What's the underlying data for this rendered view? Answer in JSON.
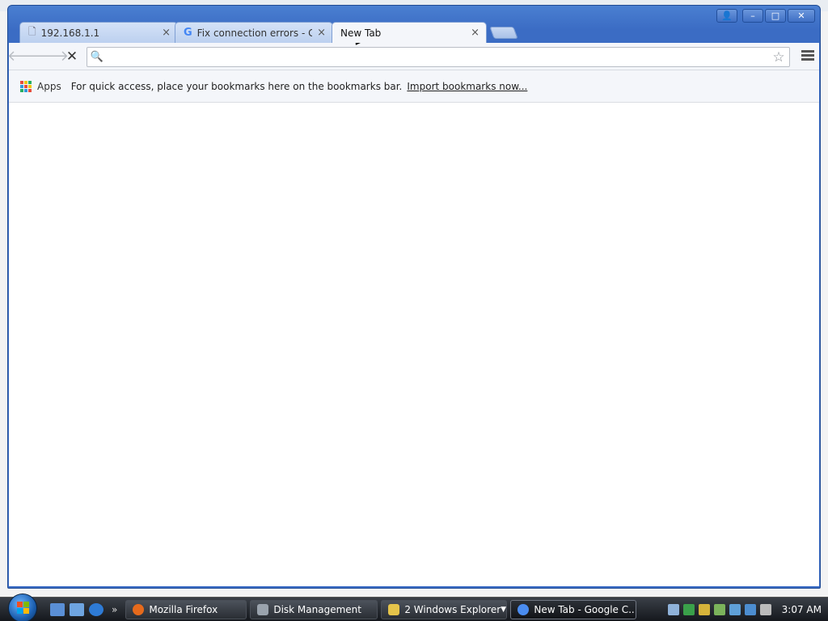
{
  "browser": {
    "tabs": [
      {
        "label": "192.168.1.1",
        "icon": "page-icon",
        "close": "×"
      },
      {
        "label": "Fix connection errors - Go",
        "icon": "google-icon",
        "close": "×"
      },
      {
        "label": "New Tab",
        "icon": "",
        "close": "×"
      }
    ],
    "omnibox": {
      "value": "",
      "placeholder": ""
    },
    "bookmarks": {
      "apps_label": "Apps",
      "hint_text": "For quick access, place your bookmarks here on the bookmarks bar.",
      "import_link": "Import bookmarks now..."
    },
    "caption": {
      "minimize": "–",
      "maximize": "□",
      "close": "✕",
      "user": "👤"
    }
  },
  "taskbar": {
    "items": [
      {
        "label": "Mozilla Firefox",
        "icon_color": "#e66a1c"
      },
      {
        "label": "Disk Management",
        "icon_color": "#9aa3ad"
      },
      {
        "label": "2 Windows Explorer",
        "icon_color": "#e5c44a"
      },
      {
        "label": "New Tab - Google C...",
        "icon_color": "#4a8cf0"
      }
    ],
    "clock": "3:07 AM",
    "overflow": "»"
  },
  "colors": {
    "window_frame": "#3b6cc4",
    "apps_grid": [
      "#e74c3c",
      "#f1c40f",
      "#27ae60",
      "#3498db",
      "#e74c3c",
      "#f1c40f",
      "#27ae60",
      "#3498db",
      "#e74c3c"
    ]
  }
}
